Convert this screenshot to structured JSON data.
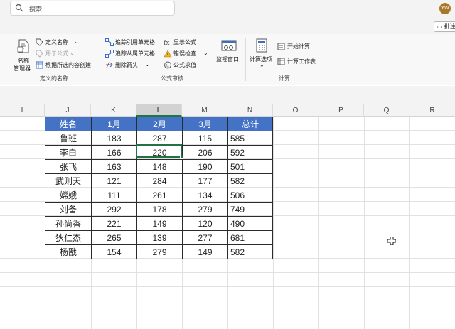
{
  "search": {
    "placeholder": "搜索"
  },
  "user": {
    "initials": "YW"
  },
  "comment_button": {
    "label": "批注"
  },
  "ribbon": {
    "defined_names": {
      "name_manager": [
        "名称",
        "管理器"
      ],
      "define_name": "定义名称",
      "use_in_formula": "用于公式",
      "create_from_selection": "根据所选内容创建",
      "group_label": "定义的名称"
    },
    "formula_auditing": {
      "trace_precedents": "追踪引用单元格",
      "trace_dependents": "追踪从属单元格",
      "remove_arrows": "删除箭头",
      "show_formulas": "显示公式",
      "error_checking": "错误检查",
      "evaluate_formula": "公式求值",
      "watch_window": "监视窗口",
      "group_label": "公式审核"
    },
    "calculation": {
      "options": "计算选项",
      "calculate_now": "开始计算",
      "calculate_sheet": "计算工作表",
      "group_label": "计算"
    }
  },
  "columns": [
    "I",
    "J",
    "K",
    "L",
    "M",
    "N",
    "O",
    "P",
    "Q",
    "R"
  ],
  "selected_column": "L",
  "table": {
    "headers": [
      "姓名",
      "1月",
      "2月",
      "3月",
      "总计"
    ],
    "rows": [
      [
        "鲁班",
        "183",
        "287",
        "115",
        "585"
      ],
      [
        "李白",
        "166",
        "220",
        "206",
        "592"
      ],
      [
        "张飞",
        "163",
        "148",
        "190",
        "501"
      ],
      [
        "武则天",
        "121",
        "284",
        "177",
        "582"
      ],
      [
        "嫦娥",
        "111",
        "261",
        "134",
        "506"
      ],
      [
        "刘备",
        "292",
        "178",
        "279",
        "749"
      ],
      [
        "孙尚香",
        "221",
        "149",
        "120",
        "490"
      ],
      [
        "狄仁杰",
        "265",
        "139",
        "277",
        "681"
      ],
      [
        "杨戬",
        "154",
        "279",
        "149",
        "582"
      ]
    ]
  },
  "colors": {
    "header_fill": "#4472c4",
    "selection": "#217346",
    "avatar": "#a8782a"
  }
}
